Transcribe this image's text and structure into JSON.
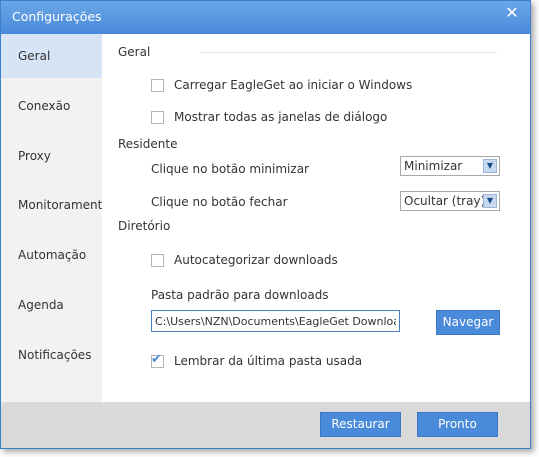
{
  "window": {
    "title": "Configurações"
  },
  "sidebar": {
    "items": [
      {
        "label": "Geral"
      },
      {
        "label": "Conexão"
      },
      {
        "label": "Proxy"
      },
      {
        "label": "Monitoramento"
      },
      {
        "label": "Automação"
      },
      {
        "label": "Agenda"
      },
      {
        "label": "Notificações"
      }
    ],
    "active_index": 0
  },
  "geral": {
    "section_label": "Geral",
    "load_on_start": {
      "label": "Carregar EagleGet ao iniciar o Windows",
      "checked": false
    },
    "show_all_dialogs": {
      "label": "Mostrar todas as janelas de diálogo",
      "checked": false
    }
  },
  "residente": {
    "section_label": "Residente",
    "minimize": {
      "label": "Clique no botão minimizar",
      "value": "Minimizar"
    },
    "close": {
      "label": "Clique no botão fechar",
      "value": "Ocultar (tray)"
    }
  },
  "diretorio": {
    "section_label": "Diretório",
    "autocategorize": {
      "label": "Autocategorizar downloads",
      "checked": false
    },
    "default_folder_label": "Pasta padrão para downloads",
    "default_folder_value": "C:\\Users\\NZN\\Documents\\EagleGet Downloads",
    "browse_label": "Navegar",
    "remember_last": {
      "label": "Lembrar da última pasta usada",
      "checked": true
    }
  },
  "footer": {
    "restore_label": "Restaurar",
    "done_label": "Pronto"
  },
  "colors": {
    "accent": "#4a8ada",
    "sidebar_active": "#d7e4f6",
    "footer_bg": "#d9d9d9"
  }
}
